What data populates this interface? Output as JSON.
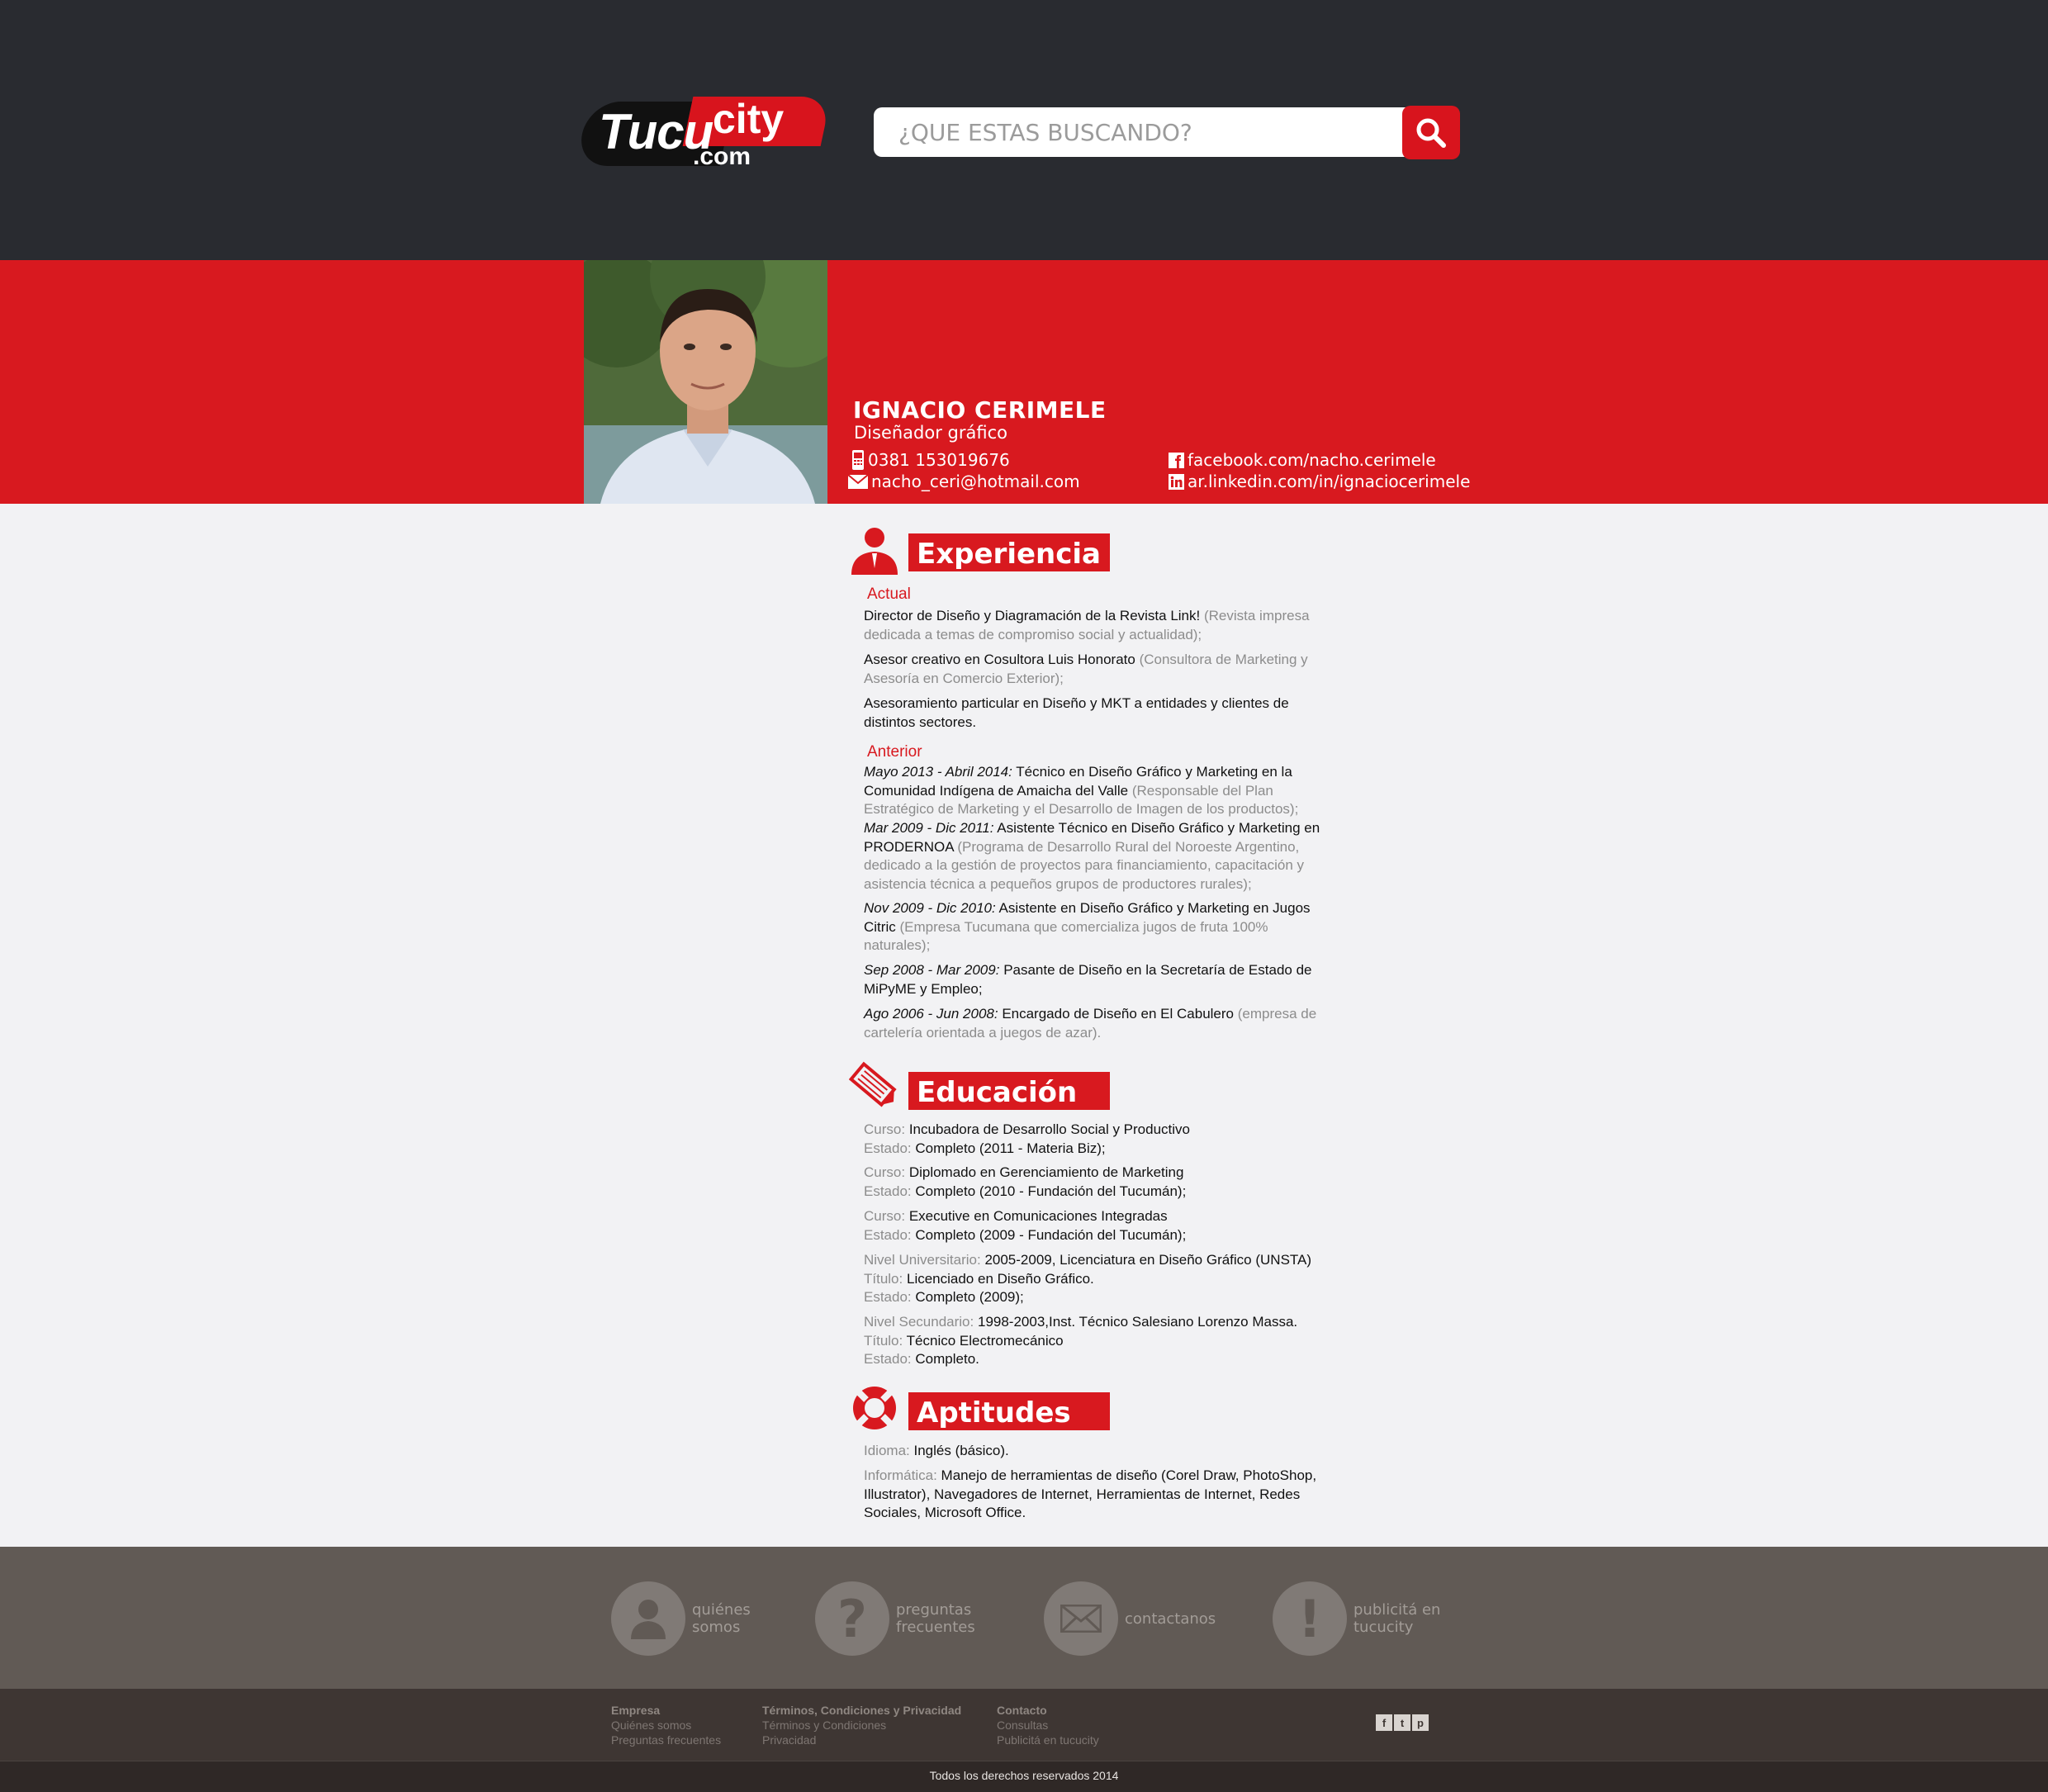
{
  "brand": {
    "logo_main": "Tucu",
    "logo_accent": "city",
    "logo_suffix": ".com"
  },
  "search": {
    "placeholder": "¿QUE ESTAS BUSCANDO?",
    "value": ""
  },
  "profile": {
    "name": "IGNACIO CERIMELE",
    "profession": "Diseñador gráfico",
    "phone": "0381 153019676",
    "email": "nacho_ceri@hotmail.com",
    "facebook": "facebook.com/nacho.cerimele",
    "linkedin": "ar.linkedin.com/in/ignaciocerimele"
  },
  "experience": {
    "title": "Experiencia",
    "current_label": "Actual",
    "previous_label": "Anterior",
    "current": [
      {
        "main": "Director de Diseño y Diagramación de la Revista Link!",
        "note": "(Revista impresa dedicada a temas de compromiso social y actualidad);"
      },
      {
        "main": "Asesor creativo en Cosultora Luis Honorato",
        "note": "(Consultora de Marketing y Asesoría en Comercio Exterior);"
      },
      {
        "main": "Asesoramiento particular en Diseño y MKT a entidades y clientes de distintos sectores.",
        "note": ""
      }
    ],
    "previous": [
      {
        "date": "Mayo 2013 - Abril 2014:",
        "main": "Técnico en Diseño Gráfico y Marketing en la Comunidad Indígena de Amaicha del Valle",
        "note": "(Responsable del Plan Estratégico de Marketing y el Desarrollo de Imagen de los productos);"
      },
      {
        "date": "Mar 2009 - Dic 2011:",
        "main": "Asistente Técnico en Diseño Gráfico y Marketing en PRODERNOA",
        "note": "(Programa de Desarrollo Rural del Noroeste Argentino, dedicado a la gestión de proyectos para financiamiento, capacitación y asistencia técnica a pequeños grupos de productores rurales);"
      },
      {
        "date": "Nov 2009 - Dic 2010:",
        "main": "Asistente en Diseño Gráfico y Marketing en Jugos Citric",
        "note": "(Empresa Tucumana que comercializa jugos de fruta 100% naturales);"
      },
      {
        "date": "Sep 2008 - Mar 2009:",
        "main": "Pasante de Diseño en la Secretaría de Estado de MiPyME y Empleo;",
        "note": ""
      },
      {
        "date": "Ago 2006 - Jun 2008:",
        "main": "Encargado de Diseño en El Cabulero",
        "note": "(empresa de cartelería orientada a juegos de azar)."
      }
    ]
  },
  "education": {
    "title": "Educación",
    "items": [
      {
        "l1": "Curso:",
        "v1": "Incubadora de Desarrollo Social y Productivo",
        "l2": "Estado:",
        "v2": "Completo (2011 - Materia Biz);"
      },
      {
        "l1": "Curso:",
        "v1": "Diplomado en Gerenciamiento de Marketing",
        "l2": "Estado:",
        "v2": "Completo (2010 - Fundación del  Tucumán);"
      },
      {
        "l1": "Curso:",
        "v1": "Executive en Comunicaciones Integradas",
        "l2": "Estado:",
        "v2": "Completo (2009 - Fundación del  Tucumán);"
      },
      {
        "l1": "Nivel Universitario:",
        "v1": "2005-2009, Licenciatura en Diseño Gráfico (UNSTA)",
        "l2": "Título:",
        "v2": "Licenciado en Diseño Gráfico.",
        "l3": "Estado:",
        "v3": "Completo (2009);"
      },
      {
        "l1": "Nivel Secundario:",
        "v1": "1998-2003,Inst. Técnico Salesiano Lorenzo Massa.",
        "l2": "Título:",
        "v2": "Técnico Electromecánico",
        "l3": "Estado:",
        "v3": "Completo."
      }
    ]
  },
  "skills": {
    "title": "Aptitudes",
    "items": [
      {
        "label": "Idioma:",
        "value": "Inglés (básico)."
      },
      {
        "label": "Informática:",
        "value": "Manejo de herramientas de diseño (Corel Draw, PhotoShop, Illustrator), Navegadores de Internet, Herramientas de Internet, Redes Sociales, Microsoft Office."
      }
    ]
  },
  "footer": {
    "nav": [
      {
        "line1": "quiénes",
        "line2": "somos",
        "icon": "person-icon"
      },
      {
        "line1": "preguntas",
        "line2": "frecuentes",
        "icon": "question-icon"
      },
      {
        "line1": "contactanos",
        "line2": "",
        "icon": "envelope-icon"
      },
      {
        "line1": "publicitá en",
        "line2": "tucucity",
        "icon": "exclamation-icon"
      }
    ],
    "links": [
      {
        "heading": "Empresa",
        "items": [
          "Quiénes somos",
          "Preguntas frecuentes"
        ]
      },
      {
        "heading": "Términos, Condiciones y Privacidad",
        "items": [
          "Términos y Condiciones",
          "Privacidad"
        ]
      },
      {
        "heading": "Contacto",
        "items": [
          "Consultas",
          "Publicitá en tucucity"
        ]
      }
    ],
    "social": [
      "f",
      "t",
      "p"
    ],
    "copyright": "Todos los derechos reservados 2014"
  },
  "colors": {
    "brand_red": "#d8191f",
    "header_dark": "#292b30",
    "footer_gray": "#615a55",
    "footer_dark": "#3e3633"
  }
}
